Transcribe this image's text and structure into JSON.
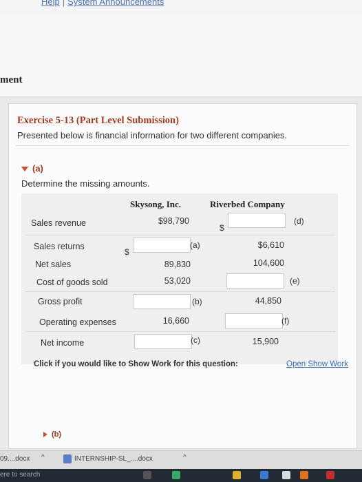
{
  "header": {
    "links": [
      "Help",
      "System Announcements"
    ],
    "page_title_fragment": "ment"
  },
  "exercise": {
    "title": "Exercise 5-13 (Part Level Submission)",
    "subtitle": "Presented below is financial information for two different companies."
  },
  "part_a": {
    "label": "(a)",
    "instruction": "Determine the missing amounts.",
    "columns": [
      "Skysong, Inc.",
      "Riverbed Company"
    ],
    "rows": [
      {
        "label": "Sales revenue",
        "skysong": "$98,790",
        "riverbed_input_letter": "(d)"
      },
      {
        "label": "Sales returns",
        "skysong_input_letter": "(a)",
        "riverbed": "$6,610"
      },
      {
        "label": "Net sales",
        "skysong": "89,830",
        "riverbed": "104,600"
      },
      {
        "label": "Cost of goods sold",
        "skysong": "53,020",
        "riverbed_input_letter": "(e)"
      },
      {
        "label": "Gross profit",
        "skysong_input_letter": "(b)",
        "riverbed": "44,850"
      },
      {
        "label": "Operating expenses",
        "skysong": "16,660",
        "riverbed_input_letter": "(f)"
      },
      {
        "label": "Net income",
        "skysong_input_letter": "(c)",
        "riverbed": "15,900"
      }
    ],
    "dollar_sign": "$",
    "show_work_prompt": "Click if you would like to Show Work for this question:",
    "show_work_link": "Open Show Work"
  },
  "part_b": {
    "label": "(b)"
  },
  "downloads": [
    {
      "name": "09....docx"
    },
    {
      "name": "INTERNSHIP-SL_....docx"
    }
  ],
  "taskbar": {
    "search_text": "ere to search"
  }
}
